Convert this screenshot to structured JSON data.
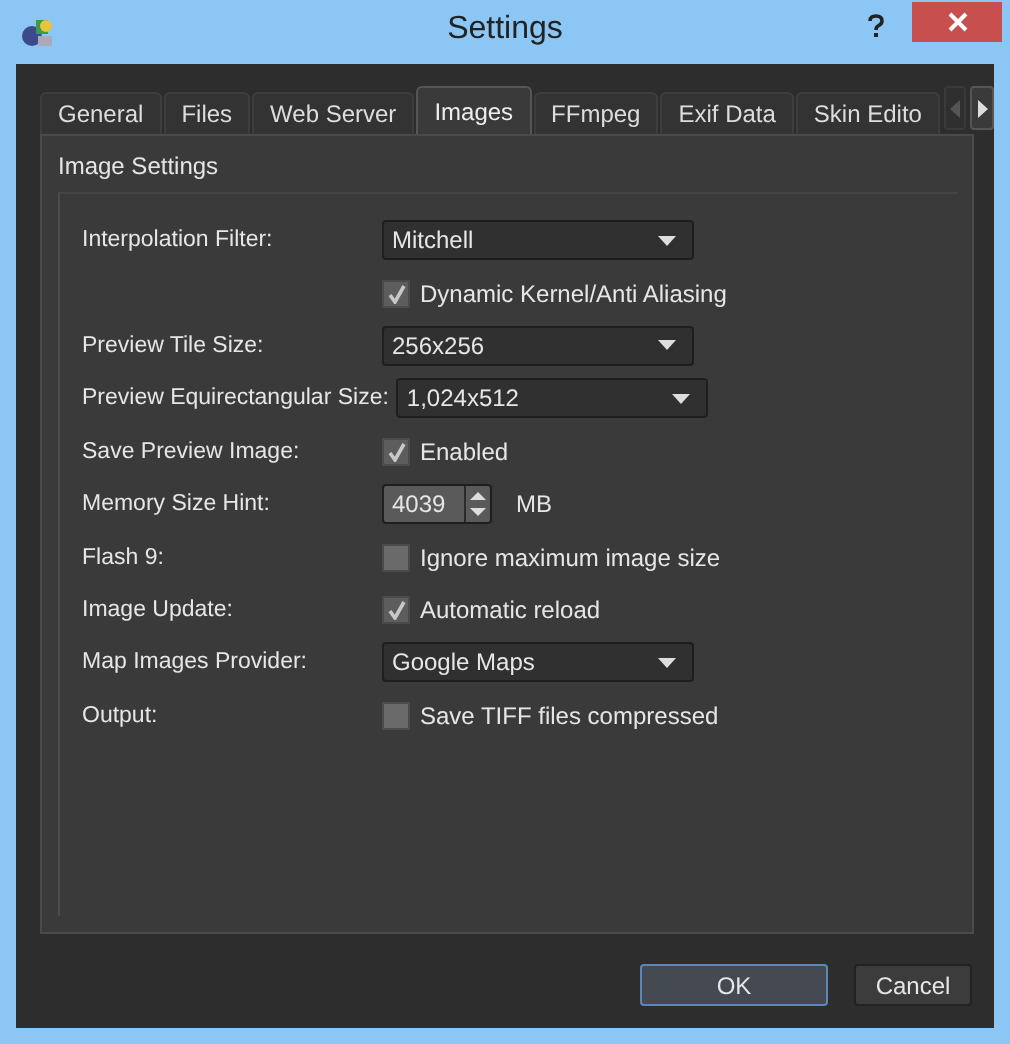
{
  "window": {
    "title": "Settings"
  },
  "tabs": [
    {
      "label": "General",
      "selected": false
    },
    {
      "label": "Files",
      "selected": false
    },
    {
      "label": "Web Server",
      "selected": false
    },
    {
      "label": "Images",
      "selected": true
    },
    {
      "label": "FFmpeg",
      "selected": false
    },
    {
      "label": "Exif Data",
      "selected": false
    },
    {
      "label": "Skin Edito",
      "selected": false
    }
  ],
  "group": {
    "title": "Image Settings"
  },
  "rows": [
    {
      "kind": "dropdown",
      "label": "Interpolation Filter:",
      "value": "Mitchell"
    },
    {
      "kind": "checkbox",
      "text": "Dynamic Kernel/Anti Aliasing",
      "checked": true
    },
    {
      "kind": "dropdown",
      "label": "Preview Tile Size:",
      "value": "256x256"
    },
    {
      "kind": "dropdown",
      "label": "Preview Equirectangular Size:",
      "value": "1,024x512"
    },
    {
      "kind": "checkbox",
      "label": "Save Preview Image:",
      "text": "Enabled",
      "checked": true
    },
    {
      "kind": "spin",
      "label": "Memory Size Hint:",
      "value": "4039",
      "unit": "MB"
    },
    {
      "kind": "checkbox",
      "label": "Flash 9:",
      "text": "Ignore maximum image size",
      "checked": false
    },
    {
      "kind": "checkbox",
      "label": "Image Update:",
      "text": "Automatic reload",
      "checked": true
    },
    {
      "kind": "dropdown",
      "label": "Map Images Provider:",
      "value": "Google Maps"
    },
    {
      "kind": "checkbox",
      "label": "Output:",
      "text": "Save TIFF files compressed",
      "checked": false
    }
  ],
  "buttons": [
    {
      "label": "OK",
      "default": true
    },
    {
      "label": "Cancel",
      "default": false
    }
  ]
}
